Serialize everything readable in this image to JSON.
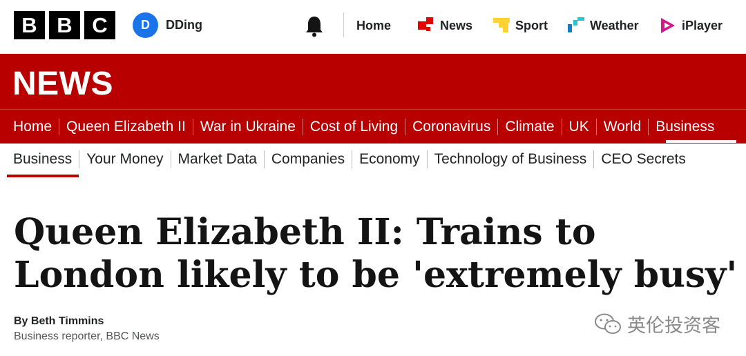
{
  "header": {
    "logo_letters": [
      "B",
      "B",
      "C"
    ],
    "account": {
      "initial": "D",
      "name": "DDing"
    },
    "notification_icon": "bell-icon",
    "nav": [
      {
        "label": "Home",
        "icon": ""
      },
      {
        "label": "News",
        "icon": "news-icon"
      },
      {
        "label": "Sport",
        "icon": "sport-icon"
      },
      {
        "label": "Weather",
        "icon": "weather-icon"
      },
      {
        "label": "iPlayer",
        "icon": "iplayer-icon"
      }
    ]
  },
  "news_banner": {
    "title": "NEWS"
  },
  "section_nav": {
    "items": [
      "Home",
      "Queen Elizabeth II",
      "War in Ukraine",
      "Cost of Living",
      "Coronavirus",
      "Climate",
      "UK",
      "World",
      "Business"
    ],
    "active": "Business"
  },
  "sub_nav": {
    "items": [
      "Business",
      "Your Money",
      "Market Data",
      "Companies",
      "Economy",
      "Technology of Business",
      "CEO Secrets"
    ],
    "active": "Business"
  },
  "article": {
    "headline": "Queen Elizabeth II: Trains to London likely to be 'extremely busy'",
    "author": "By Beth Timmins",
    "role": "Business reporter, BBC News"
  },
  "watermark": {
    "text": "英伦投资客",
    "icon": "wechat-icon"
  },
  "colors": {
    "brand_red": "#b80000",
    "avatar_blue": "#1a73e8"
  }
}
